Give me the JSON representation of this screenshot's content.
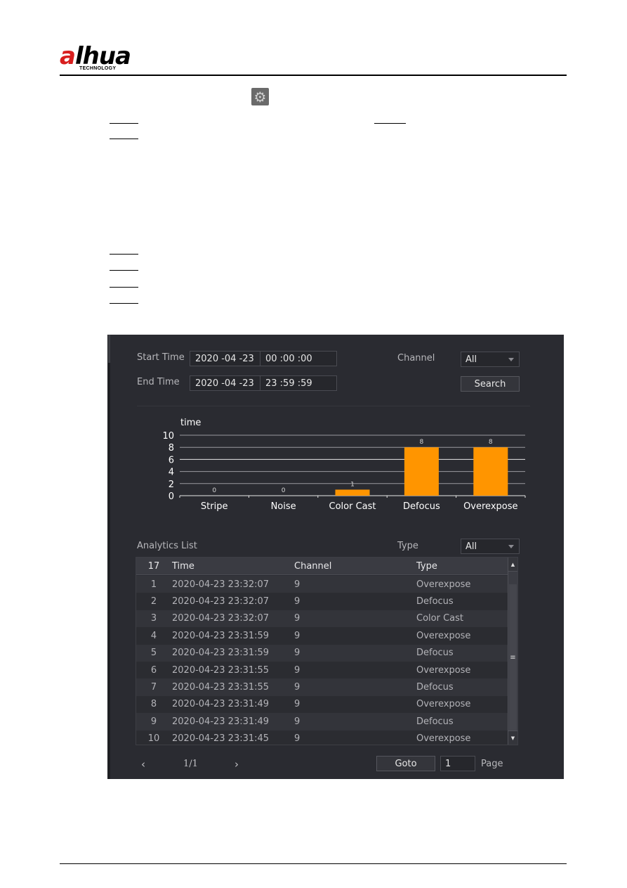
{
  "document": {
    "brand": {
      "logo_word_a": "a",
      "logo_word_rest": "lhua",
      "logo_sub": "TECHNOLOGY"
    },
    "inline_icon": "gear-icon"
  },
  "panel": {
    "start_time": {
      "label": "Start Time",
      "date": "2020 -04 -23",
      "time": "00 :00 :00"
    },
    "end_time": {
      "label": "End Time",
      "date": "2020 -04 -23",
      "time": "23 :59 :59"
    },
    "channel": {
      "label": "Channel",
      "value": "All"
    },
    "search_button": "Search",
    "analytics_list": {
      "title": "Analytics List",
      "type_label": "Type",
      "type_value": "All",
      "columns": {
        "count": "17",
        "time": "Time",
        "channel": "Channel",
        "type": "Type"
      },
      "rows": [
        {
          "no": "1",
          "time": "2020-04-23 23:32:07",
          "channel": "9",
          "type": "Overexpose"
        },
        {
          "no": "2",
          "time": "2020-04-23 23:32:07",
          "channel": "9",
          "type": "Defocus"
        },
        {
          "no": "3",
          "time": "2020-04-23 23:32:07",
          "channel": "9",
          "type": "Color Cast"
        },
        {
          "no": "4",
          "time": "2020-04-23 23:31:59",
          "channel": "9",
          "type": "Overexpose"
        },
        {
          "no": "5",
          "time": "2020-04-23 23:31:59",
          "channel": "9",
          "type": "Defocus"
        },
        {
          "no": "6",
          "time": "2020-04-23 23:31:55",
          "channel": "9",
          "type": "Overexpose"
        },
        {
          "no": "7",
          "time": "2020-04-23 23:31:55",
          "channel": "9",
          "type": "Defocus"
        },
        {
          "no": "8",
          "time": "2020-04-23 23:31:49",
          "channel": "9",
          "type": "Overexpose"
        },
        {
          "no": "9",
          "time": "2020-04-23 23:31:49",
          "channel": "9",
          "type": "Defocus"
        },
        {
          "no": "10",
          "time": "2020-04-23 23:31:45",
          "channel": "9",
          "type": "Overexpose"
        }
      ]
    },
    "pager": {
      "prev": "‹",
      "next": "›",
      "page_indicator": "1/1",
      "goto_button": "Goto",
      "page_input": "1",
      "page_label": "Page"
    }
  },
  "chart_data": {
    "type": "bar",
    "title": "",
    "ylabel": "time",
    "xlabel": "",
    "categories": [
      "Stripe",
      "Noise",
      "Color Cast",
      "Defocus",
      "Overexpose"
    ],
    "values": [
      0,
      0,
      1,
      8,
      8
    ],
    "data_labels": [
      "0",
      "0",
      "1",
      "8",
      "8"
    ],
    "ylim": [
      0,
      10
    ],
    "yticks": [
      0,
      2,
      4,
      6,
      8,
      10
    ],
    "grid": true,
    "bar_color": "#ff9500",
    "legend": "none"
  },
  "colors": {
    "panel_bg": "#2a2b31",
    "accent_bar": "#ff9500",
    "brand_red": "#d81e1e"
  }
}
